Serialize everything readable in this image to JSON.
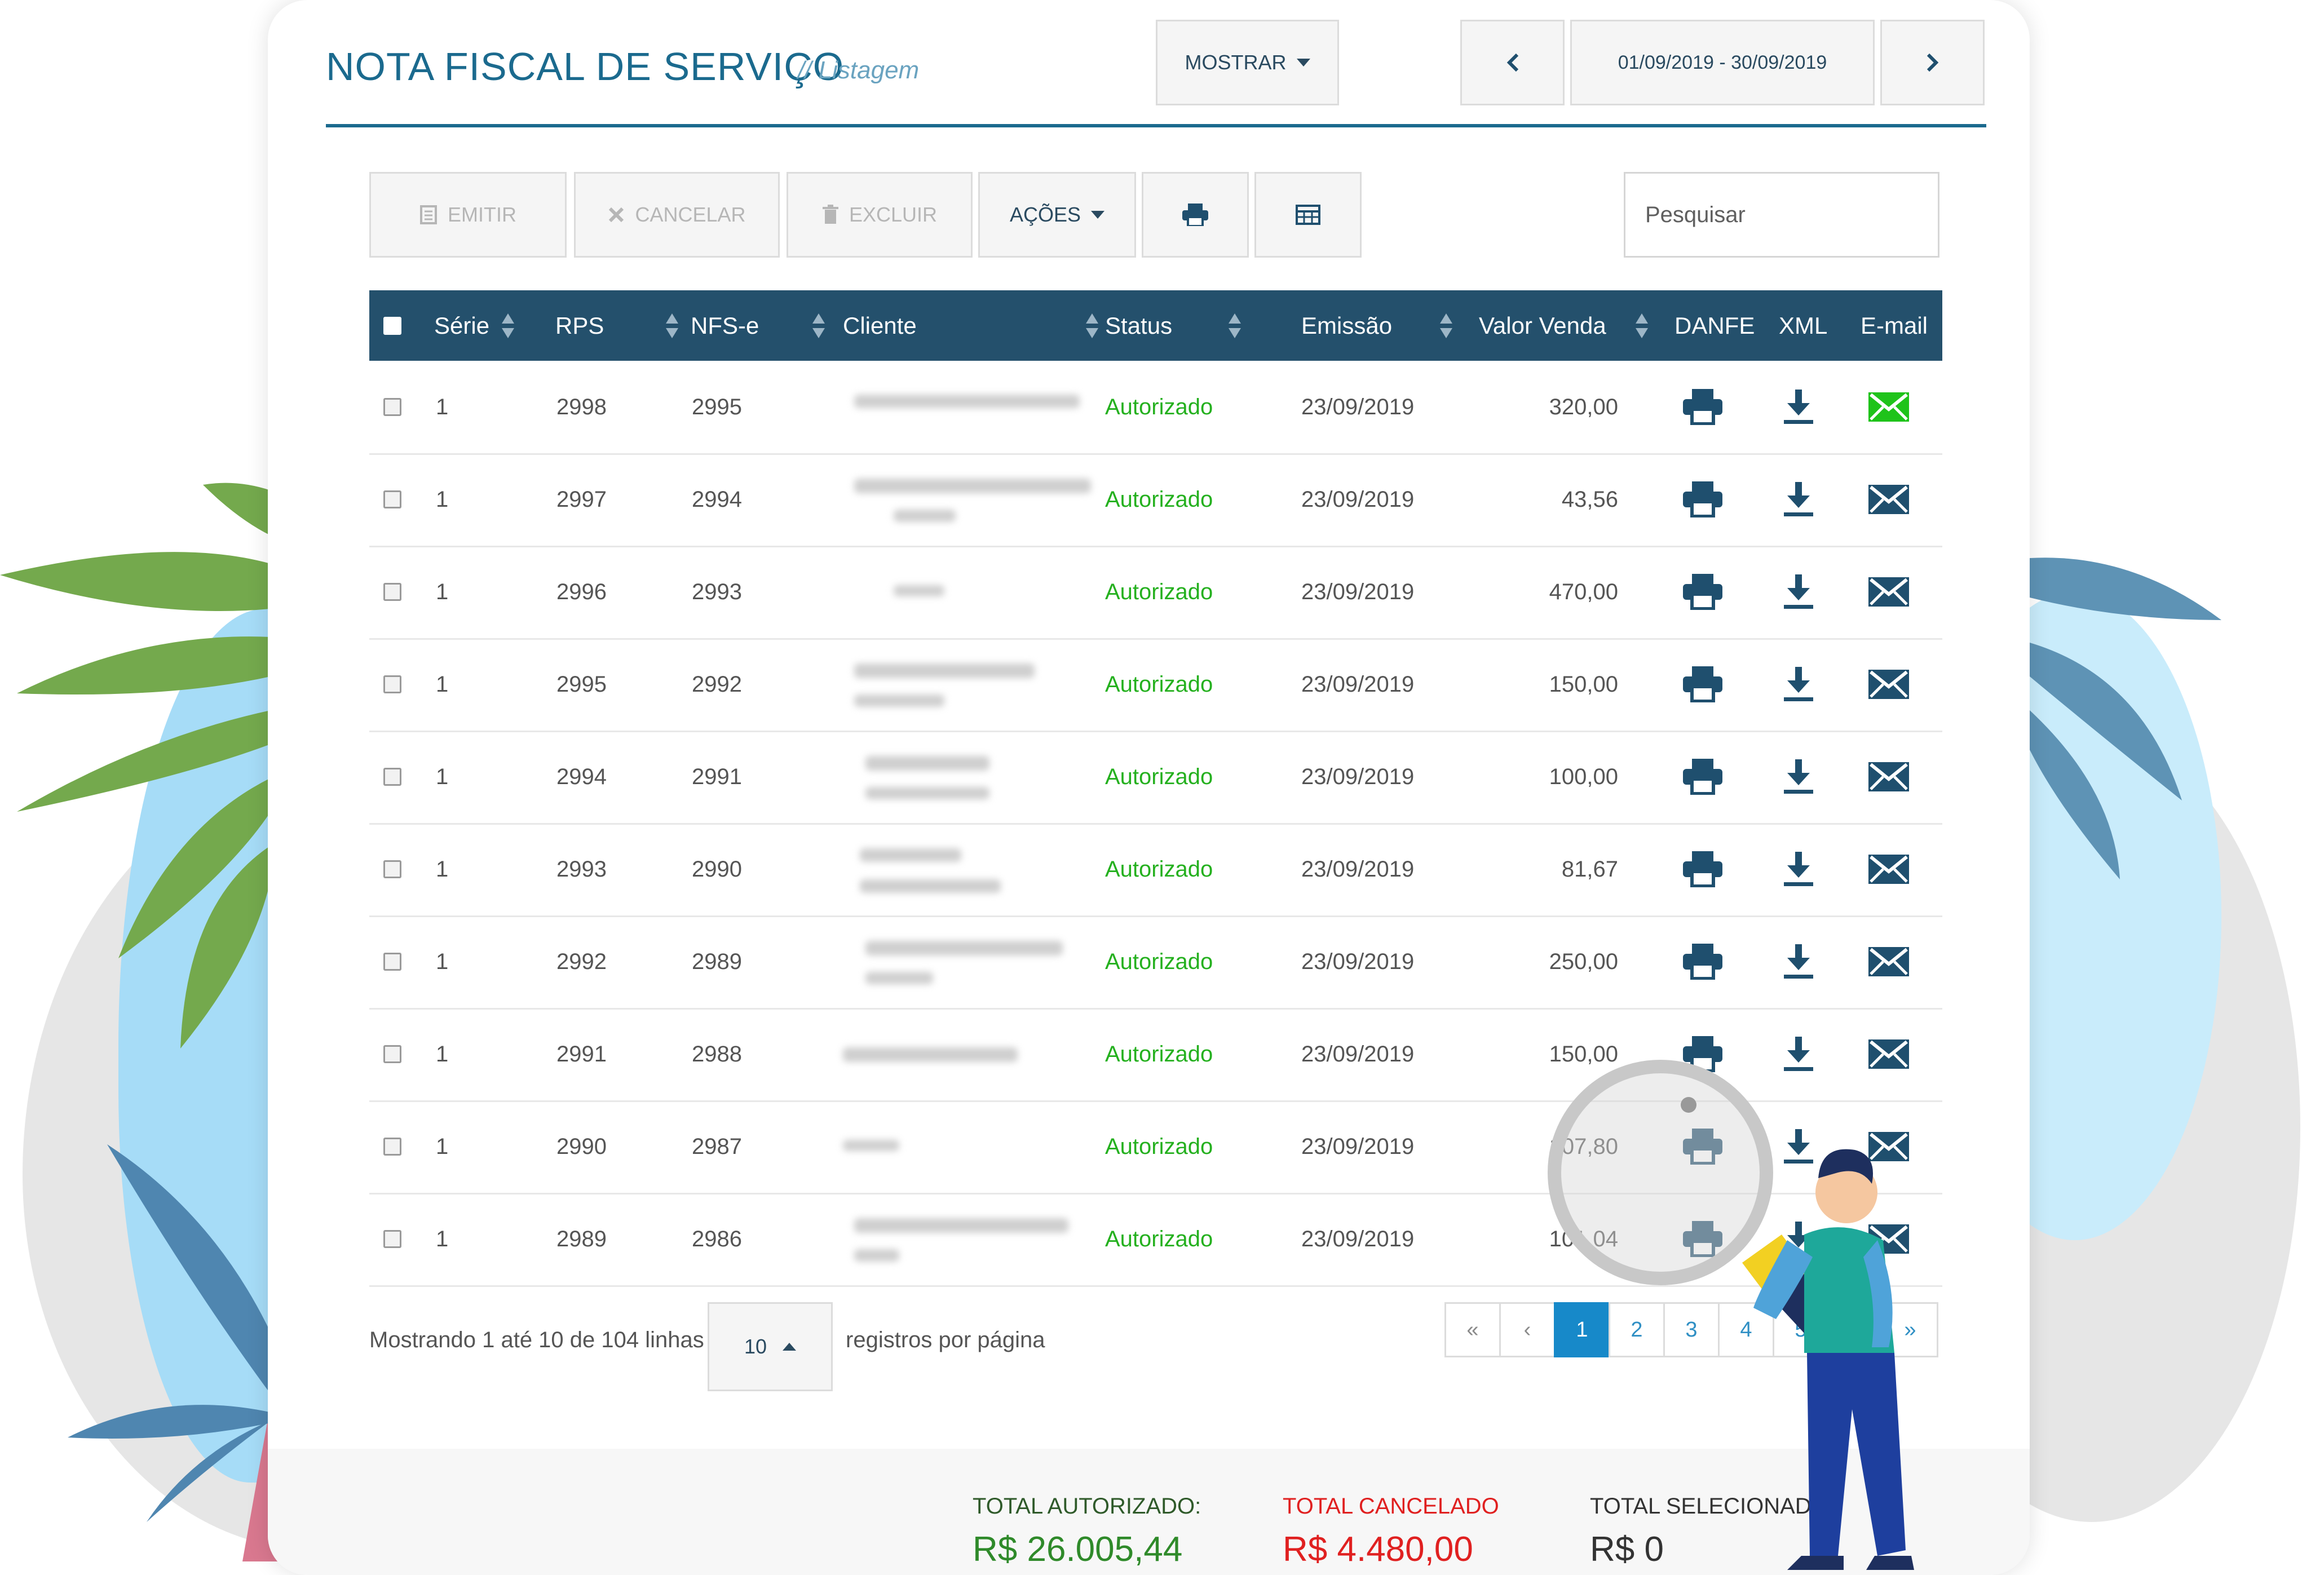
{
  "header": {
    "title": "NOTA FISCAL DE SERVIÇO",
    "subtitle": "// Listagem",
    "show_button": "MOSTRAR",
    "date_range": "01/09/2019 - 30/09/2019"
  },
  "toolbar": {
    "emit": "EMITIR",
    "cancel": "CANCELAR",
    "delete": "EXCLUIR",
    "actions": "AÇÕES",
    "search_placeholder": "Pesquisar"
  },
  "table": {
    "columns": [
      "Série",
      "RPS",
      "NFS-e",
      "Cliente",
      "Status",
      "Emissão",
      "Valor Venda",
      "DANFE",
      "XML",
      "E-mail"
    ],
    "rows": [
      {
        "serie": "1",
        "rps": "2998",
        "nfse": "2995",
        "status": "Autorizado",
        "emissao": "23/09/2019",
        "valor": "320,00",
        "email_sent": true
      },
      {
        "serie": "1",
        "rps": "2997",
        "nfse": "2994",
        "status": "Autorizado",
        "emissao": "23/09/2019",
        "valor": "43,56",
        "email_sent": false
      },
      {
        "serie": "1",
        "rps": "2996",
        "nfse": "2993",
        "status": "Autorizado",
        "emissao": "23/09/2019",
        "valor": "470,00",
        "email_sent": false
      },
      {
        "serie": "1",
        "rps": "2995",
        "nfse": "2992",
        "status": "Autorizado",
        "emissao": "23/09/2019",
        "valor": "150,00",
        "email_sent": false
      },
      {
        "serie": "1",
        "rps": "2994",
        "nfse": "2991",
        "status": "Autorizado",
        "emissao": "23/09/2019",
        "valor": "100,00",
        "email_sent": false
      },
      {
        "serie": "1",
        "rps": "2993",
        "nfse": "2990",
        "status": "Autorizado",
        "emissao": "23/09/2019",
        "valor": "81,67",
        "email_sent": false
      },
      {
        "serie": "1",
        "rps": "2992",
        "nfse": "2989",
        "status": "Autorizado",
        "emissao": "23/09/2019",
        "valor": "250,00",
        "email_sent": false
      },
      {
        "serie": "1",
        "rps": "2991",
        "nfse": "2988",
        "status": "Autorizado",
        "emissao": "23/09/2019",
        "valor": "150,00",
        "email_sent": false
      },
      {
        "serie": "1",
        "rps": "2990",
        "nfse": "2987",
        "status": "Autorizado",
        "emissao": "23/09/2019",
        "valor": "107,80",
        "email_sent": false
      },
      {
        "serie": "1",
        "rps": "2989",
        "nfse": "2986",
        "status": "Autorizado",
        "emissao": "23/09/2019",
        "valor": "101,04",
        "email_sent": false
      }
    ]
  },
  "footer": {
    "showing": "Mostrando 1 até 10 de 104 linhas",
    "per_page_value": "10",
    "per_page_label": "registros por página",
    "pages": [
      "«",
      "‹",
      "1",
      "2",
      "3",
      "4",
      "5",
      "›",
      "»"
    ],
    "active_page": "1"
  },
  "totals": {
    "authorized_label": "TOTAL AUTORIZADO:",
    "authorized_value": "R$ 26.005,44",
    "canceled_label": "TOTAL CANCELADO",
    "canceled_value": "R$ 4.480,00",
    "selected_label": "TOTAL SELECIONADO",
    "selected_value": "R$ 0"
  },
  "colors": {
    "primary": "#1b6a8e",
    "table_header": "#24506c",
    "status_ok": "#24b01e",
    "total_authorized": "#2f8a2a",
    "total_canceled": "#e02020",
    "total_selected": "#333333",
    "email_sent": "#1fc31a",
    "icon": "#1f4f6e"
  },
  "icons": {
    "danfe": "printer-icon",
    "xml": "download-icon",
    "email": "envelope-icon"
  }
}
